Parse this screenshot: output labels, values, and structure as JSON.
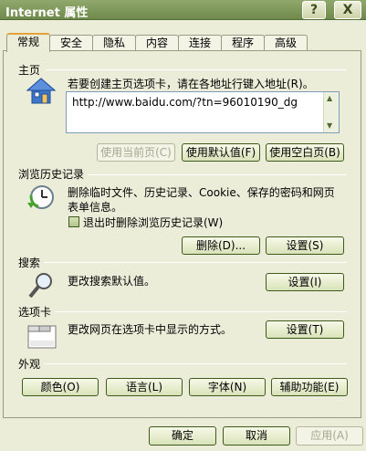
{
  "window": {
    "title": "Internet 属性",
    "help_glyph": "?",
    "close_glyph": "X"
  },
  "tabs": [
    "常规",
    "安全",
    "隐私",
    "内容",
    "连接",
    "程序",
    "高级"
  ],
  "homepage": {
    "group_label": "主页",
    "description": "若要创建主页选项卡，请在各地址行键入地址(R)。",
    "url": "http://www.baidu.com/?tn=96010190_dg",
    "buttons": {
      "use_current": "使用当前页(C)",
      "use_default": "使用默认值(F)",
      "use_blank": "使用空白页(B)"
    }
  },
  "history": {
    "group_label": "浏览历史记录",
    "description": "删除临时文件、历史记录、Cookie、保存的密码和网页表单信息。",
    "checkbox_label": "退出时删除浏览历史记录(W)",
    "checkbox_checked": false,
    "buttons": {
      "delete": "删除(D)...",
      "settings": "设置(S)"
    }
  },
  "search": {
    "group_label": "搜索",
    "description": "更改搜索默认值。",
    "settings": "设置(I)"
  },
  "tabs_section": {
    "group_label": "选项卡",
    "description": "更改网页在选项卡中显示的方式。",
    "settings": "设置(T)"
  },
  "appearance": {
    "group_label": "外观",
    "buttons": {
      "colors": "颜色(O)",
      "languages": "语言(L)",
      "fonts": "字体(N)",
      "accessibility": "辅助功能(E)"
    }
  },
  "footer": {
    "ok": "确定",
    "cancel": "取消",
    "apply": "应用(A)"
  },
  "colors": {
    "title_bar": "#7a9656",
    "tab_highlight": "#e6a03b",
    "panel_bg": "#ecedd9"
  }
}
